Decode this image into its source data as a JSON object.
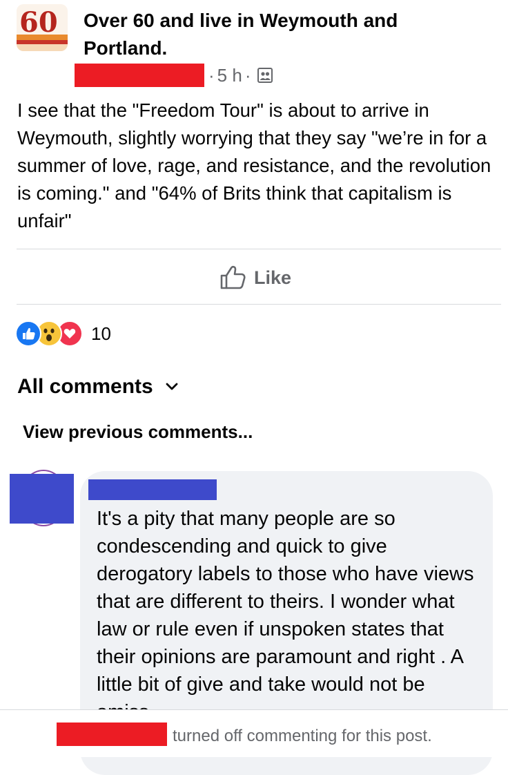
{
  "group": {
    "name": "Over 60 and live in Weymouth and Portland.",
    "logo_text": "60"
  },
  "post": {
    "time": "5 h",
    "separator": "·",
    "audience_icon": "group-members-icon",
    "text": "I see that the \"Freedom Tour\" is about to arrive in Weymouth, slightly worrying that they say \"we’re in for a summer of love, rage, and resistance, and the revolution is coming.\" and \"64% of Brits think that capitalism is unfair\""
  },
  "actions": {
    "like_label": "Like"
  },
  "reactions": {
    "types": [
      "like",
      "wow",
      "love"
    ],
    "count": "10"
  },
  "comments": {
    "sort_label": "All comments",
    "view_previous": "View previous comments...",
    "items": [
      {
        "text": "It's a pity that many people are so condescending and quick to give derogatory labels to those who have views that are different to theirs. I wonder what law or rule even if unspoken states that their opinions are paramount and right . A little bit of give and take would not be amiss."
      }
    ]
  },
  "footer": {
    "text": "turned off commenting for this post."
  },
  "colors": {
    "redaction_red": "#ec1c24",
    "redaction_blue": "#3e4acb",
    "secondary_text": "#65676b",
    "bubble": "#f0f2f5"
  }
}
